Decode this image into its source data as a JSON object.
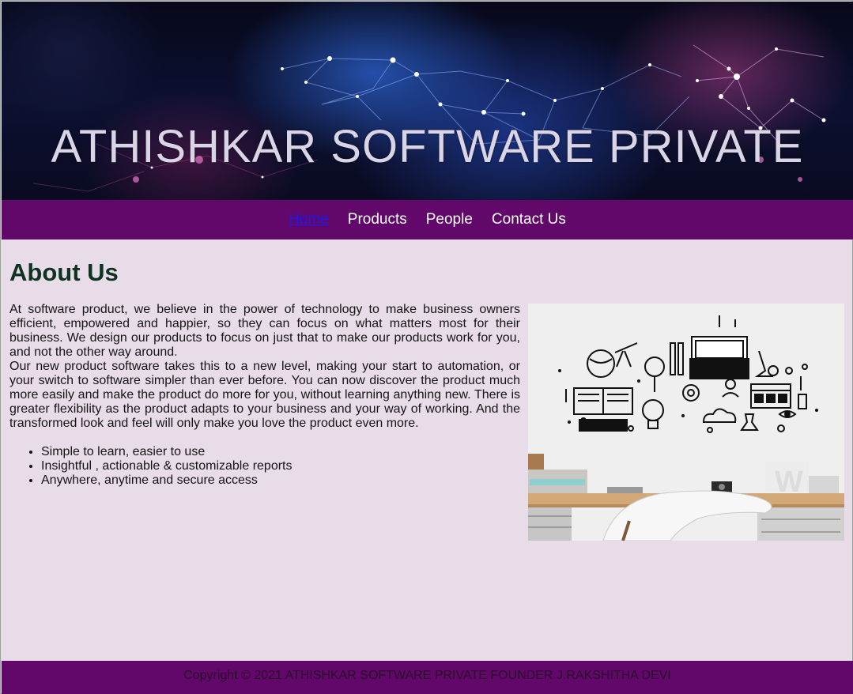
{
  "header": {
    "title": "ATHISHKAR SOFTWARE PRIVATE"
  },
  "nav": {
    "items": [
      {
        "label": "Home",
        "active": true
      },
      {
        "label": "Products",
        "active": false
      },
      {
        "label": "People",
        "active": false
      },
      {
        "label": "Contact Us",
        "active": false
      }
    ]
  },
  "main": {
    "heading": "About Us",
    "paragraph1": "At software product, we believe in the power of technology to make business owners efficient, empowered and happier, so they can focus on what matters most for their business. We design our products to focus on just that to make our products work for you, and not the other way around.",
    "paragraph2": "Our new product software takes this to a new level, making your start to automation, or your switch to software simpler than ever before. You can now discover the product much more easily and make the product do more for you, without learning anything new. There is greater flexibility as the product adapts to your business and your way of working. And the transformed look and feel will only make you love the product even more.",
    "features": [
      "Simple to learn, easier to use",
      "Insightful , actionable & customizable reports",
      "Anywhere, anytime and secure access"
    ]
  },
  "footer": {
    "copyright": "Copyright © 2021 ATHISHKAR SOFTWARE PRIVATE FOUNDER J.RAKSHITHA DEVI"
  },
  "colors": {
    "nav_bg": "#62086a",
    "page_bg": "#e8dce8",
    "heading": "#0f3320",
    "active_link": "#1a1aee"
  }
}
